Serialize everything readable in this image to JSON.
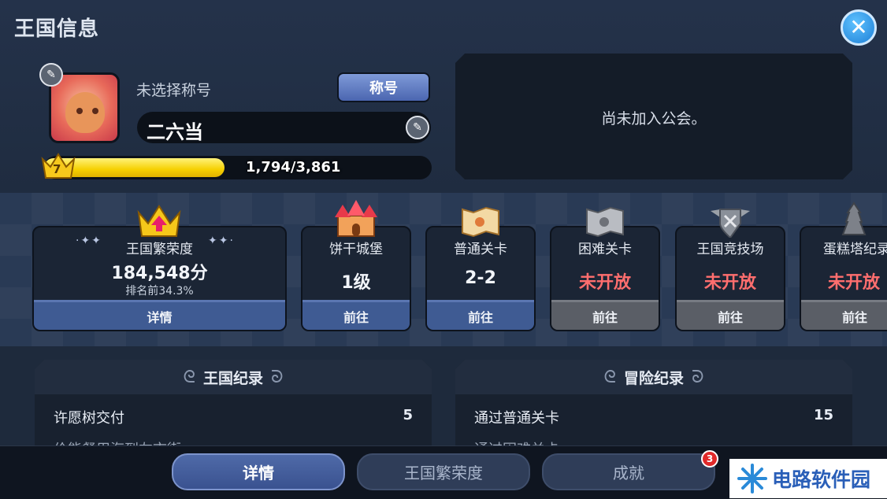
{
  "window": {
    "title": "王国信息"
  },
  "profile": {
    "title_status": "未选择称号",
    "title_button": "称号",
    "name": "二六当",
    "level": "7",
    "xp_text": "1,794/3,861",
    "xp_progress": 0.465
  },
  "guild": {
    "status": "尚未加入公会。"
  },
  "cards": [
    {
      "label": "王国繁荣度",
      "value": "184,548分",
      "sub": "排名前34.3%",
      "button": "详情",
      "icon": "crown-icon"
    },
    {
      "label": "饼干城堡",
      "value": "1级",
      "button": "前往",
      "icon": "castle-icon"
    },
    {
      "label": "普通关卡",
      "value": "2-2",
      "button": "前往",
      "icon": "map-icon"
    },
    {
      "label": "困难关卡",
      "value": "未开放",
      "button": "前往",
      "icon": "dark-map-icon"
    },
    {
      "label": "王国竞技场",
      "value": "未开放",
      "button": "前往",
      "icon": "shield-icon"
    },
    {
      "label": "蛋糕塔纪录",
      "value": "未开放",
      "button": "前往",
      "icon": "tower-icon"
    }
  ],
  "kingdom_record": {
    "title": "王国纪录",
    "rows": [
      {
        "label": "许愿树交付",
        "value": "5"
      },
      {
        "label": "价能餐用海到左市街",
        "value": ""
      }
    ]
  },
  "adventure_record": {
    "title": "冒险纪录",
    "rows": [
      {
        "label": "通过普通关卡",
        "value": "15"
      },
      {
        "label": "通过困难关卡",
        "value": ""
      }
    ]
  },
  "tabs": [
    {
      "label": "详情",
      "active": true
    },
    {
      "label": "王国繁荣度",
      "active": false
    },
    {
      "label": "成就",
      "active": false,
      "badge": "3"
    }
  ],
  "watermark": {
    "text": "电路软件园"
  },
  "colors": {
    "accent": "#4f6aa8",
    "xp": "#f6d000",
    "closed": "#ff6e6e"
  }
}
